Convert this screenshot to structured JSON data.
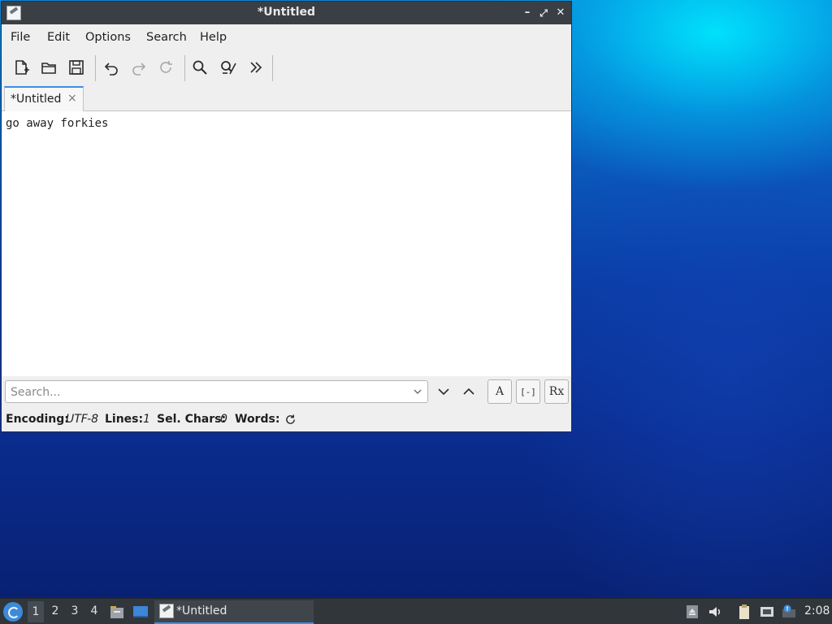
{
  "window": {
    "title": "*Untitled",
    "controls": {
      "minimize": "–",
      "maximize": "⤢",
      "close": "✕"
    }
  },
  "menu": [
    "File",
    "Edit",
    "Options",
    "Search",
    "Help"
  ],
  "toolbar": {
    "icons": [
      "new-document-icon",
      "open-folder-icon",
      "save-icon",
      "undo-icon",
      "redo-icon",
      "reload-icon",
      "find-icon",
      "find-replace-icon",
      "more-icon"
    ]
  },
  "tabs": [
    {
      "label": "*Untitled",
      "close": "×"
    }
  ],
  "editor": {
    "text": "go away forkies"
  },
  "findbar": {
    "placeholder": "Search...",
    "match_case": "A",
    "whole_word": "[-]",
    "regex": "Rx"
  },
  "status": {
    "encoding_label": "Encoding:",
    "encoding_value": "UTF-8",
    "lines_label": "Lines:",
    "lines_value": "1",
    "sel_label": "Sel. Chars:",
    "sel_value": "0",
    "words_label": "Words:"
  },
  "taskbar": {
    "workspaces": [
      "1",
      "2",
      "3",
      "4"
    ],
    "task_label": "*Untitled",
    "clock": "2:08"
  },
  "colors": {
    "accent": "#3d8ee4",
    "titlebar": "#3a3f45",
    "taskbar": "#31363b"
  }
}
